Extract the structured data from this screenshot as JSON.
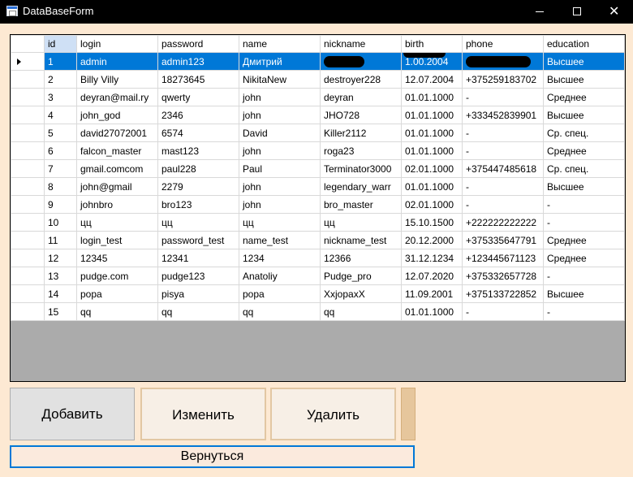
{
  "window": {
    "title": "DataBaseForm"
  },
  "grid": {
    "columns": [
      "id",
      "login",
      "password",
      "name",
      "nickname",
      "birth",
      "phone",
      "education"
    ],
    "selected_row": 0,
    "rows": [
      [
        "1",
        "admin",
        "admin123",
        "Дмитрий",
        "",
        "1.00.2004",
        "",
        "Высшее"
      ],
      [
        "2",
        "Billy Villy",
        "18273645",
        "NikitaNew",
        "destroyer228",
        "12.07.2004",
        "+375259183702",
        "Высшее"
      ],
      [
        "3",
        "deyran@mail.ry",
        "qwerty",
        "john",
        "deyran",
        "01.01.1000",
        "-",
        "Среднее"
      ],
      [
        "4",
        "john_god",
        "2346",
        "john",
        "JHO728",
        "01.01.1000",
        "+333452839901",
        "Высшее"
      ],
      [
        "5",
        "david27072001",
        "6574",
        "David",
        "Killer2112",
        "01.01.1000",
        "-",
        "Ср. спец."
      ],
      [
        "6",
        "falcon_master",
        "mast123",
        "john",
        "roga23",
        "01.01.1000",
        "-",
        "Среднее"
      ],
      [
        "7",
        "gmail.comcom",
        "paul228",
        "Paul",
        "Terminator3000",
        "02.01.1000",
        "+375447485618",
        "Ср. спец."
      ],
      [
        "8",
        "john@gmail",
        "2279",
        "john",
        "legendary_warr",
        "01.01.1000",
        "-",
        "Высшее"
      ],
      [
        "9",
        "johnbro",
        "bro123",
        "john",
        "bro_master",
        "02.01.1000",
        "-",
        "-"
      ],
      [
        "10",
        "цц",
        "цц",
        "цц",
        "цц",
        "15.10.1500",
        "+222222222222",
        "-"
      ],
      [
        "11",
        "login_test",
        "password_test",
        "name_test",
        "nickname_test",
        "20.12.2000",
        "+375335647791",
        "Среднее"
      ],
      [
        "12",
        "12345",
        "12341",
        "1234",
        "12366",
        "31.12.1234",
        "+123445671123",
        "Среднее"
      ],
      [
        "13",
        "pudge.com",
        "pudge123",
        "Anatoliy",
        "Pudge_pro",
        "12.07.2020",
        "+375332657728",
        "-"
      ],
      [
        "14",
        "popa",
        "pisya",
        "popa",
        "XxjopaxX",
        "11.09.2001",
        "+375133722852",
        "Высшее"
      ],
      [
        "15",
        "qq",
        "qq",
        "qq",
        "qq",
        "01.01.1000",
        "-",
        "-"
      ]
    ]
  },
  "buttons": {
    "add": "Добавить",
    "edit": "Изменить",
    "delete": "Удалить",
    "back": "Вернуться"
  }
}
